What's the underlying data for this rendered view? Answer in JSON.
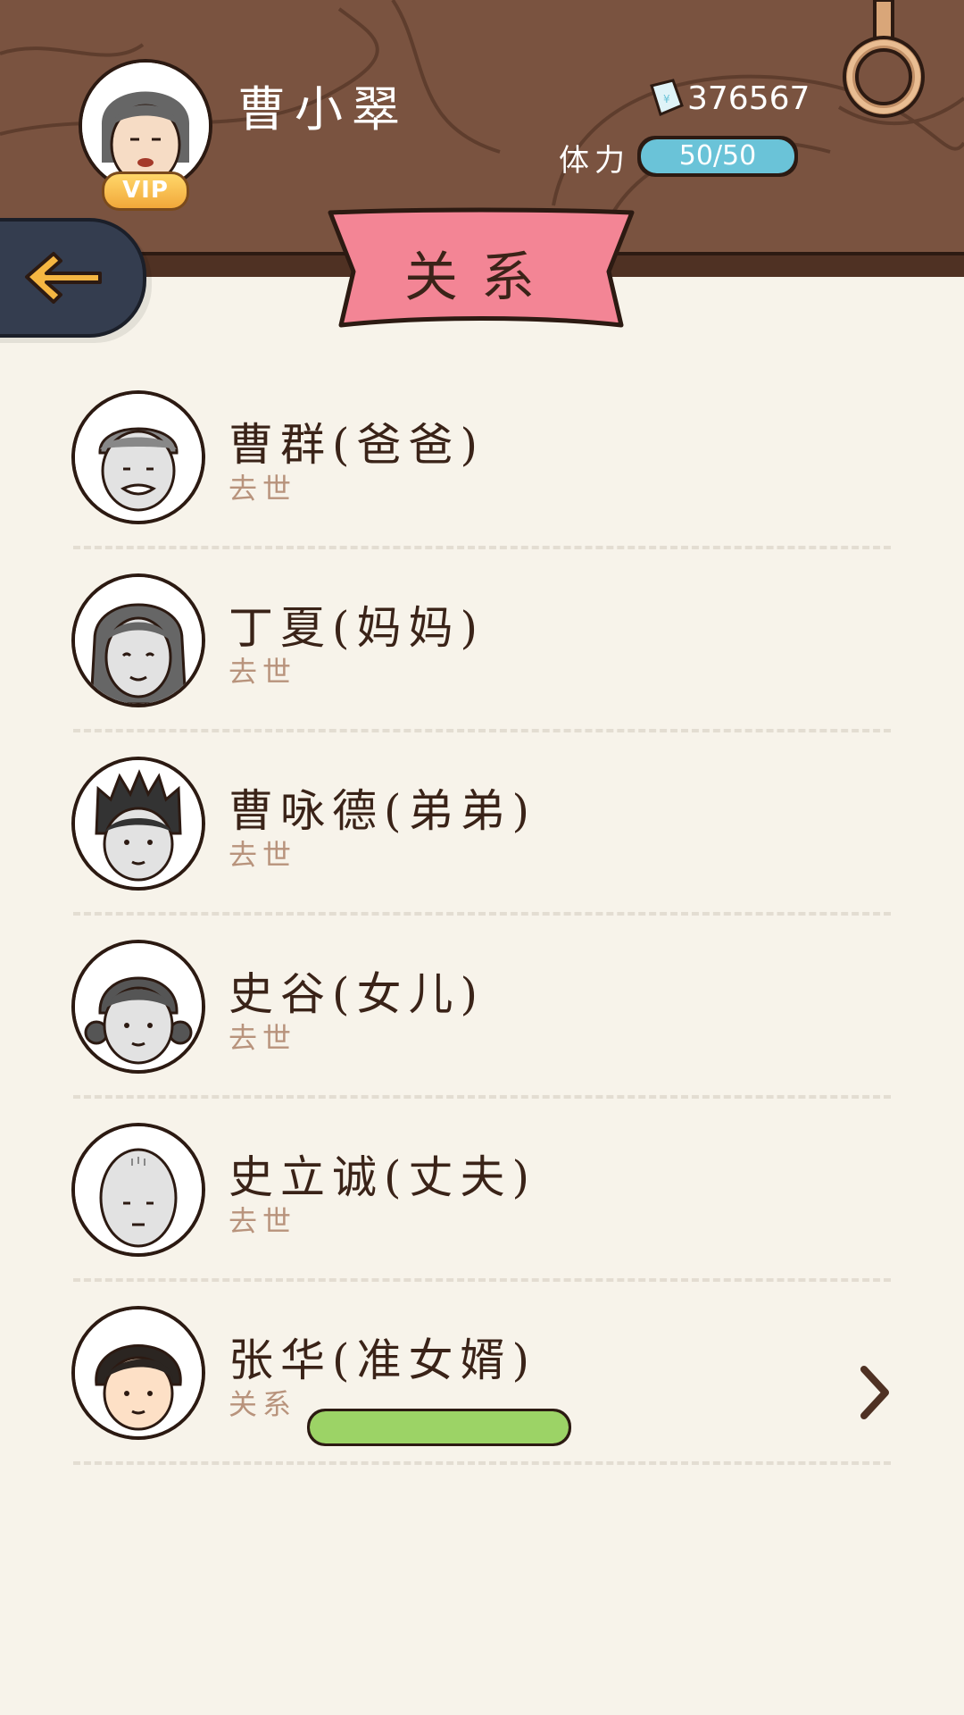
{
  "player": {
    "name": "曹小翠",
    "vip_label": "VIP",
    "money": "376567",
    "stamina_label": "体力",
    "stamina_text": "50/50",
    "stamina_fraction": 1.0
  },
  "page": {
    "title": "关系"
  },
  "relations": [
    {
      "name": "曹群(爸爸)",
      "status": "去世",
      "avatar": "bald-old-man"
    },
    {
      "name": "丁夏(妈妈)",
      "status": "去世",
      "avatar": "long-hair-woman"
    },
    {
      "name": "曹咏德(弟弟)",
      "status": "去世",
      "avatar": "spiky-hair-man"
    },
    {
      "name": "史谷(女儿)",
      "status": "去世",
      "avatar": "bun-hair-girl"
    },
    {
      "name": "史立诚(丈夫)",
      "status": "去世",
      "avatar": "bald-man"
    },
    {
      "name": "张华(准女婿)",
      "status": "关系",
      "avatar": "young-man",
      "relationship_fraction": 1.0
    }
  ],
  "colors": {
    "header_wood": "#7a5340",
    "ribbon_pink": "#f38595",
    "stamina_blue": "#6ac3d8",
    "relation_green": "#9cd366",
    "back_button": "#343d4f",
    "arrow_yellow": "#f5b642"
  },
  "icons": {
    "money": "money-note-icon",
    "back": "back-arrow-icon",
    "settings": "ring-icon",
    "row_next": "chevron-right-icon"
  }
}
